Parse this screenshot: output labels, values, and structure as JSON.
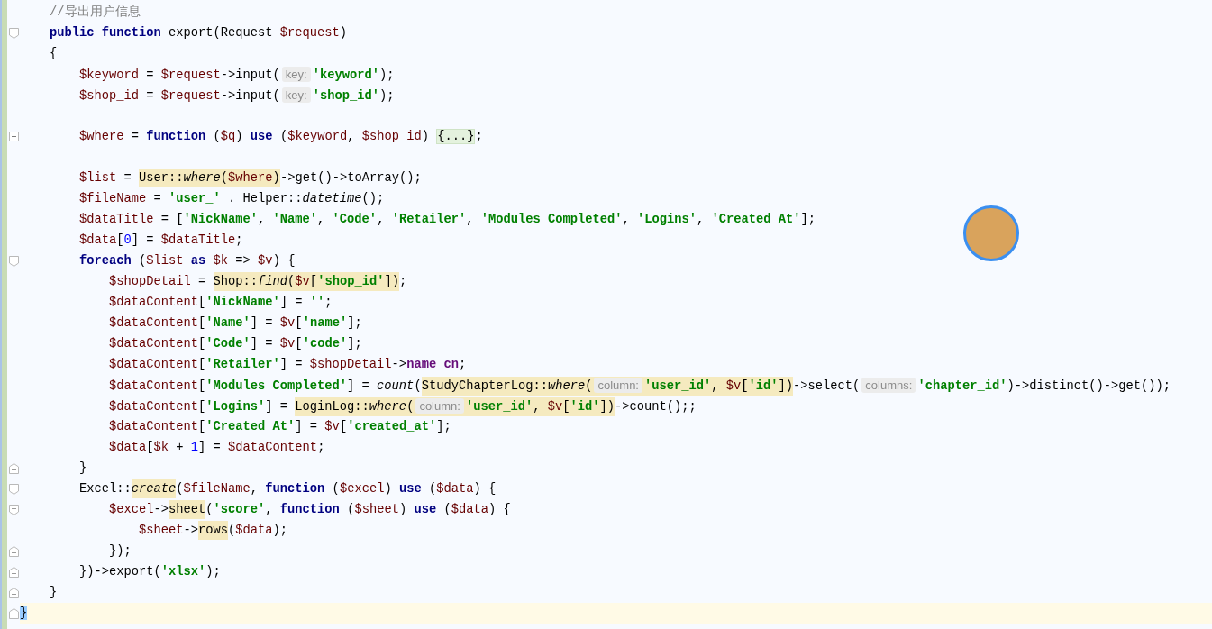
{
  "editor": {
    "avatar": {
      "kind": "photo"
    },
    "lines": [
      {
        "kind": "code",
        "current": false,
        "tokens": [
          {
            "kind": "comment",
            "text": "    //导出用户信息"
          }
        ]
      },
      {
        "kind": "code",
        "current": false,
        "fold": {
          "expanded": true,
          "end": false
        },
        "tokens": [
          {
            "kind": "kw",
            "text": "    public function"
          },
          {
            "kind": "plain",
            "text": " export(Request "
          },
          {
            "kind": "var",
            "text": "$request"
          },
          {
            "kind": "plain",
            "text": ")"
          }
        ]
      },
      {
        "kind": "code",
        "current": false,
        "tokens": [
          {
            "kind": "plain",
            "text": "    {"
          }
        ]
      },
      {
        "kind": "code",
        "current": false,
        "tokens": [
          {
            "kind": "var",
            "text": "        $keyword"
          },
          {
            "kind": "plain",
            "text": " = "
          },
          {
            "kind": "var",
            "text": "$request"
          },
          {
            "kind": "plain",
            "text": "->input("
          },
          {
            "kind": "hint",
            "text": "key:"
          },
          {
            "kind": "str",
            "text": "'keyword'"
          },
          {
            "kind": "plain",
            "text": ");"
          }
        ]
      },
      {
        "kind": "code",
        "current": false,
        "tokens": [
          {
            "kind": "var",
            "text": "        $shop_id"
          },
          {
            "kind": "plain",
            "text": " = "
          },
          {
            "kind": "var",
            "text": "$request"
          },
          {
            "kind": "plain",
            "text": "->input("
          },
          {
            "kind": "hint",
            "text": "key:"
          },
          {
            "kind": "str",
            "text": "'shop_id'"
          },
          {
            "kind": "plain",
            "text": ");"
          }
        ]
      },
      {
        "kind": "blank",
        "current": false
      },
      {
        "kind": "code",
        "current": false,
        "fold": {
          "expanded": false
        },
        "tokens": [
          {
            "kind": "var",
            "text": "        $where"
          },
          {
            "kind": "plain",
            "text": " = "
          },
          {
            "kind": "kw",
            "text": "function"
          },
          {
            "kind": "plain",
            "text": " ("
          },
          {
            "kind": "var",
            "text": "$q"
          },
          {
            "kind": "plain",
            "text": ") "
          },
          {
            "kind": "kw",
            "text": "use"
          },
          {
            "kind": "plain",
            "text": " ("
          },
          {
            "kind": "var",
            "text": "$keyword"
          },
          {
            "kind": "plain",
            "text": ", "
          },
          {
            "kind": "var",
            "text": "$shop_id"
          },
          {
            "kind": "plain",
            "text": ") "
          },
          {
            "kind": "folded",
            "text": "{...}"
          },
          {
            "kind": "plain",
            "text": ";"
          }
        ]
      },
      {
        "kind": "blank",
        "current": false
      },
      {
        "kind": "code",
        "current": false,
        "tokens": [
          {
            "kind": "var",
            "text": "        $list"
          },
          {
            "kind": "plain",
            "text": " = "
          },
          {
            "kind": "highlight",
            "children": [
              {
                "kind": "plain",
                "text": "User::"
              },
              {
                "kind": "italic",
                "text": "where"
              },
              {
                "kind": "plain",
                "text": "("
              },
              {
                "kind": "var",
                "text": "$where"
              },
              {
                "kind": "plain",
                "text": ")"
              }
            ]
          },
          {
            "kind": "plain",
            "text": "->get()->toArray();"
          }
        ]
      },
      {
        "kind": "code",
        "current": false,
        "tokens": [
          {
            "kind": "var",
            "text": "        $fileName"
          },
          {
            "kind": "plain",
            "text": " = "
          },
          {
            "kind": "str",
            "text": "'user_'"
          },
          {
            "kind": "plain",
            "text": " . Helper::"
          },
          {
            "kind": "italic",
            "text": "datetime"
          },
          {
            "kind": "plain",
            "text": "();"
          }
        ]
      },
      {
        "kind": "code",
        "current": false,
        "tokens": [
          {
            "kind": "var",
            "text": "        $dataTitle"
          },
          {
            "kind": "plain",
            "text": " = ["
          },
          {
            "kind": "str",
            "text": "'NickName'"
          },
          {
            "kind": "plain",
            "text": ", "
          },
          {
            "kind": "str",
            "text": "'Name'"
          },
          {
            "kind": "plain",
            "text": ", "
          },
          {
            "kind": "str",
            "text": "'Code'"
          },
          {
            "kind": "plain",
            "text": ", "
          },
          {
            "kind": "str",
            "text": "'Retailer'"
          },
          {
            "kind": "plain",
            "text": ", "
          },
          {
            "kind": "str",
            "text": "'Modules Completed'"
          },
          {
            "kind": "plain",
            "text": ", "
          },
          {
            "kind": "str",
            "text": "'Logins'"
          },
          {
            "kind": "plain",
            "text": ", "
          },
          {
            "kind": "str",
            "text": "'Created At'"
          },
          {
            "kind": "plain",
            "text": "];"
          }
        ]
      },
      {
        "kind": "code",
        "current": false,
        "tokens": [
          {
            "kind": "var",
            "text": "        $data"
          },
          {
            "kind": "plain",
            "text": "["
          },
          {
            "kind": "num",
            "text": "0"
          },
          {
            "kind": "plain",
            "text": "] = "
          },
          {
            "kind": "var",
            "text": "$dataTitle"
          },
          {
            "kind": "plain",
            "text": ";"
          }
        ]
      },
      {
        "kind": "code",
        "current": false,
        "fold": {
          "expanded": true,
          "end": false
        },
        "tokens": [
          {
            "kind": "kw",
            "text": "        foreach"
          },
          {
            "kind": "plain",
            "text": " ("
          },
          {
            "kind": "var",
            "text": "$list"
          },
          {
            "kind": "kw",
            "text": " as "
          },
          {
            "kind": "var",
            "text": "$k"
          },
          {
            "kind": "plain",
            "text": " => "
          },
          {
            "kind": "var",
            "text": "$v"
          },
          {
            "kind": "plain",
            "text": ") {"
          }
        ]
      },
      {
        "kind": "code",
        "current": false,
        "tokens": [
          {
            "kind": "var",
            "text": "            $shopDetail"
          },
          {
            "kind": "plain",
            "text": " = "
          },
          {
            "kind": "highlight",
            "children": [
              {
                "kind": "plain",
                "text": "Shop::"
              },
              {
                "kind": "italic",
                "text": "find"
              },
              {
                "kind": "plain",
                "text": "("
              },
              {
                "kind": "var",
                "text": "$v"
              },
              {
                "kind": "plain",
                "text": "["
              },
              {
                "kind": "str",
                "text": "'shop_id'"
              },
              {
                "kind": "plain",
                "text": "])"
              }
            ]
          },
          {
            "kind": "plain",
            "text": ";"
          }
        ]
      },
      {
        "kind": "code",
        "current": false,
        "tokens": [
          {
            "kind": "var",
            "text": "            $dataContent"
          },
          {
            "kind": "plain",
            "text": "["
          },
          {
            "kind": "str",
            "text": "'NickName'"
          },
          {
            "kind": "plain",
            "text": "] = "
          },
          {
            "kind": "str",
            "text": "''"
          },
          {
            "kind": "plain",
            "text": ";"
          }
        ]
      },
      {
        "kind": "code",
        "current": false,
        "tokens": [
          {
            "kind": "var",
            "text": "            $dataContent"
          },
          {
            "kind": "plain",
            "text": "["
          },
          {
            "kind": "str",
            "text": "'Name'"
          },
          {
            "kind": "plain",
            "text": "] = "
          },
          {
            "kind": "var",
            "text": "$v"
          },
          {
            "kind": "plain",
            "text": "["
          },
          {
            "kind": "str",
            "text": "'name'"
          },
          {
            "kind": "plain",
            "text": "];"
          }
        ]
      },
      {
        "kind": "code",
        "current": false,
        "tokens": [
          {
            "kind": "var",
            "text": "            $dataContent"
          },
          {
            "kind": "plain",
            "text": "["
          },
          {
            "kind": "str",
            "text": "'Code'"
          },
          {
            "kind": "plain",
            "text": "] = "
          },
          {
            "kind": "var",
            "text": "$v"
          },
          {
            "kind": "plain",
            "text": "["
          },
          {
            "kind": "str",
            "text": "'code'"
          },
          {
            "kind": "plain",
            "text": "];"
          }
        ]
      },
      {
        "kind": "code",
        "current": false,
        "tokens": [
          {
            "kind": "var",
            "text": "            $dataContent"
          },
          {
            "kind": "plain",
            "text": "["
          },
          {
            "kind": "str",
            "text": "'Retailer'"
          },
          {
            "kind": "plain",
            "text": "] = "
          },
          {
            "kind": "var",
            "text": "$shopDetail"
          },
          {
            "kind": "plain",
            "text": "->"
          },
          {
            "kind": "field",
            "text": "name_cn"
          },
          {
            "kind": "plain",
            "text": ";"
          }
        ]
      },
      {
        "kind": "code",
        "current": false,
        "tokens": [
          {
            "kind": "var",
            "text": "            $dataContent"
          },
          {
            "kind": "plain",
            "text": "["
          },
          {
            "kind": "str",
            "text": "'Modules Completed'"
          },
          {
            "kind": "plain",
            "text": "] = "
          },
          {
            "kind": "italic",
            "text": "count"
          },
          {
            "kind": "plain",
            "text": "("
          },
          {
            "kind": "highlight",
            "children": [
              {
                "kind": "plain",
                "text": "StudyChapterLog::"
              },
              {
                "kind": "italic",
                "text": "where"
              },
              {
                "kind": "plain",
                "text": "("
              },
              {
                "kind": "hint",
                "text": "column:"
              },
              {
                "kind": "str",
                "text": "'user_id'"
              },
              {
                "kind": "plain",
                "text": ", "
              },
              {
                "kind": "var",
                "text": "$v"
              },
              {
                "kind": "plain",
                "text": "["
              },
              {
                "kind": "str",
                "text": "'id'"
              },
              {
                "kind": "plain",
                "text": "])"
              }
            ]
          },
          {
            "kind": "plain",
            "text": "->select("
          },
          {
            "kind": "hint",
            "text": "columns:"
          },
          {
            "kind": "str",
            "text": "'chapter_id'"
          },
          {
            "kind": "plain",
            "text": ")->distinct()->get());"
          }
        ]
      },
      {
        "kind": "code",
        "current": false,
        "tokens": [
          {
            "kind": "var",
            "text": "            $dataContent"
          },
          {
            "kind": "plain",
            "text": "["
          },
          {
            "kind": "str",
            "text": "'Logins'"
          },
          {
            "kind": "plain",
            "text": "] = "
          },
          {
            "kind": "highlight",
            "children": [
              {
                "kind": "plain",
                "text": "LoginLog::"
              },
              {
                "kind": "italic",
                "text": "where"
              },
              {
                "kind": "plain",
                "text": "("
              },
              {
                "kind": "hint",
                "text": "column:"
              },
              {
                "kind": "str",
                "text": "'user_id'"
              },
              {
                "kind": "plain",
                "text": ", "
              },
              {
                "kind": "var",
                "text": "$v"
              },
              {
                "kind": "plain",
                "text": "["
              },
              {
                "kind": "str",
                "text": "'id'"
              },
              {
                "kind": "plain",
                "text": "])"
              }
            ]
          },
          {
            "kind": "plain",
            "text": "->count();;"
          }
        ]
      },
      {
        "kind": "code",
        "current": false,
        "tokens": [
          {
            "kind": "var",
            "text": "            $dataContent"
          },
          {
            "kind": "plain",
            "text": "["
          },
          {
            "kind": "str",
            "text": "'Created At'"
          },
          {
            "kind": "plain",
            "text": "] = "
          },
          {
            "kind": "var",
            "text": "$v"
          },
          {
            "kind": "plain",
            "text": "["
          },
          {
            "kind": "str",
            "text": "'created_at'"
          },
          {
            "kind": "plain",
            "text": "];"
          }
        ]
      },
      {
        "kind": "code",
        "current": false,
        "tokens": [
          {
            "kind": "var",
            "text": "            $data"
          },
          {
            "kind": "plain",
            "text": "["
          },
          {
            "kind": "var",
            "text": "$k"
          },
          {
            "kind": "plain",
            "text": " + "
          },
          {
            "kind": "num",
            "text": "1"
          },
          {
            "kind": "plain",
            "text": "] = "
          },
          {
            "kind": "var",
            "text": "$dataContent"
          },
          {
            "kind": "plain",
            "text": ";"
          }
        ]
      },
      {
        "kind": "code",
        "current": false,
        "fold": {
          "expanded": true,
          "end": true
        },
        "tokens": [
          {
            "kind": "plain",
            "text": "        }"
          }
        ]
      },
      {
        "kind": "code",
        "current": false,
        "fold": {
          "expanded": true,
          "end": false
        },
        "tokens": [
          {
            "kind": "plain",
            "text": "        Excel::"
          },
          {
            "kind": "highlight",
            "children": [
              {
                "kind": "italic",
                "text": "create"
              }
            ]
          },
          {
            "kind": "plain",
            "text": "("
          },
          {
            "kind": "var",
            "text": "$fileName"
          },
          {
            "kind": "plain",
            "text": ", "
          },
          {
            "kind": "kw",
            "text": "function"
          },
          {
            "kind": "plain",
            "text": " ("
          },
          {
            "kind": "var",
            "text": "$excel"
          },
          {
            "kind": "plain",
            "text": ") "
          },
          {
            "kind": "kw",
            "text": "use"
          },
          {
            "kind": "plain",
            "text": " ("
          },
          {
            "kind": "var",
            "text": "$data"
          },
          {
            "kind": "plain",
            "text": ") {"
          }
        ]
      },
      {
        "kind": "code",
        "current": false,
        "fold": {
          "expanded": true,
          "end": false
        },
        "tokens": [
          {
            "kind": "var",
            "text": "            $excel"
          },
          {
            "kind": "plain",
            "text": "->"
          },
          {
            "kind": "highlight",
            "children": [
              {
                "kind": "plain",
                "text": "sheet"
              }
            ]
          },
          {
            "kind": "plain",
            "text": "("
          },
          {
            "kind": "str",
            "text": "'score'"
          },
          {
            "kind": "plain",
            "text": ", "
          },
          {
            "kind": "kw",
            "text": "function"
          },
          {
            "kind": "plain",
            "text": " ("
          },
          {
            "kind": "var",
            "text": "$sheet"
          },
          {
            "kind": "plain",
            "text": ") "
          },
          {
            "kind": "kw",
            "text": "use"
          },
          {
            "kind": "plain",
            "text": " ("
          },
          {
            "kind": "var",
            "text": "$data"
          },
          {
            "kind": "plain",
            "text": ") {"
          }
        ]
      },
      {
        "kind": "code",
        "current": false,
        "tokens": [
          {
            "kind": "var",
            "text": "                $sheet"
          },
          {
            "kind": "plain",
            "text": "->"
          },
          {
            "kind": "highlight",
            "children": [
              {
                "kind": "plain",
                "text": "rows"
              }
            ]
          },
          {
            "kind": "plain",
            "text": "("
          },
          {
            "kind": "var",
            "text": "$data"
          },
          {
            "kind": "plain",
            "text": ");"
          }
        ]
      },
      {
        "kind": "code",
        "current": false,
        "fold": {
          "expanded": true,
          "end": true
        },
        "tokens": [
          {
            "kind": "plain",
            "text": "            });"
          }
        ]
      },
      {
        "kind": "code",
        "current": false,
        "fold": {
          "expanded": true,
          "end": true
        },
        "tokens": [
          {
            "kind": "plain",
            "text": "        })->export("
          },
          {
            "kind": "str",
            "text": "'xlsx'"
          },
          {
            "kind": "plain",
            "text": ");"
          }
        ]
      },
      {
        "kind": "code",
        "current": false,
        "fold": {
          "expanded": true,
          "end": true
        },
        "tokens": [
          {
            "kind": "plain",
            "text": "    }"
          }
        ]
      },
      {
        "kind": "code",
        "current": true,
        "fold": {
          "expanded": true,
          "end": true
        },
        "tokens": [
          {
            "kind": "matched",
            "text": "}"
          }
        ]
      }
    ]
  }
}
